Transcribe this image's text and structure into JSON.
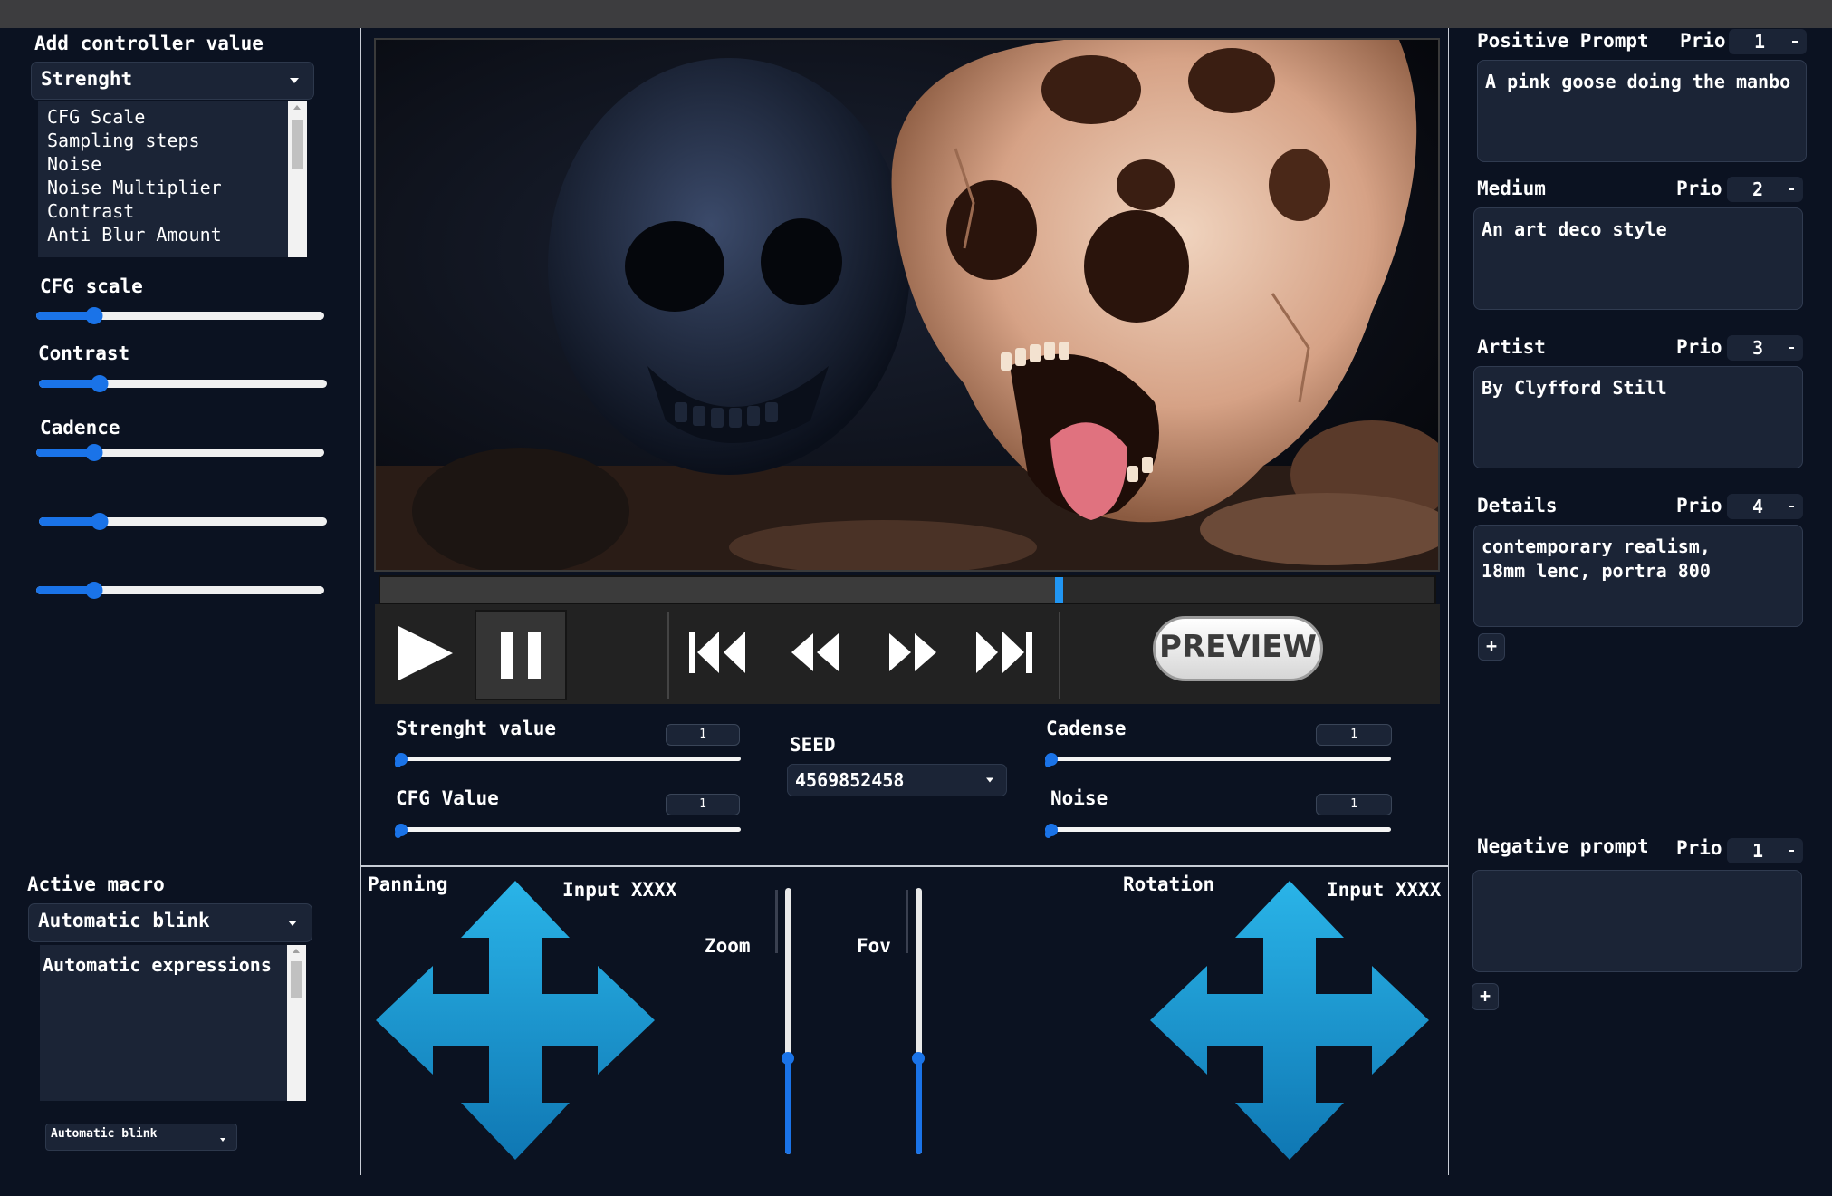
{
  "left_panel": {
    "add_controller_title": "Add controller value",
    "controller_select": "Strenght",
    "controller_list": [
      "CFG Scale",
      "Sampling steps",
      "Noise",
      "Noise Multiplier",
      "Contrast",
      "Anti Blur Amount"
    ],
    "sliders": [
      {
        "label": "CFG scale",
        "value": 0.2
      },
      {
        "label": "Contrast",
        "value": 0.21
      },
      {
        "label": "Cadence",
        "value": 0.2
      },
      {
        "label": "",
        "value": 0.21
      },
      {
        "label": "",
        "value": 0.2
      }
    ],
    "active_macro_title": "Active macro",
    "macro_select": "Automatic blink",
    "macro_list": [
      "Automatic expressions"
    ],
    "macro_small_select": "Automatic blink"
  },
  "player": {
    "progress": 0.64,
    "preview_label": "PREVIEW",
    "icons": [
      "play-icon",
      "pause-icon",
      "skip-to-start-icon",
      "rewind-icon",
      "fast-forward-icon",
      "skip-to-end-icon"
    ]
  },
  "params": {
    "strength_label": "Strenght value",
    "strength_value": "1",
    "strength_level": 0.0,
    "cfg_label": "CFG Value",
    "cfg_value": "1",
    "cfg_level": 0.0,
    "seed_label": "SEED",
    "seed_value": "4569852458",
    "cadense_label": "Cadense",
    "cadense_value": "1",
    "cadense_level": 0.0,
    "noise_label": "Noise",
    "noise_value": "1",
    "noise_level": 0.0
  },
  "motion": {
    "panning_label": "Panning",
    "panning_input": "Input XXXX",
    "zoom_label": "Zoom",
    "zoom_level": 0.36,
    "fov_label": "Fov",
    "fov_level": 0.36,
    "rotation_label": "Rotation",
    "rotation_input": "Input XXXX"
  },
  "prompts": {
    "prio_label": "Prio",
    "positive": {
      "label": "Positive Prompt",
      "prio": "1",
      "text": "A pink goose doing the manbo"
    },
    "medium": {
      "label": "Medium",
      "prio": "2",
      "text": "An art deco style"
    },
    "artist": {
      "label": "Artist",
      "prio": "3",
      "text": "By Clyfford Still"
    },
    "details": {
      "label": "Details",
      "prio": "4",
      "text": "contemporary realism,\n18mm lenc, portra 800"
    },
    "negative": {
      "label": "Negative prompt",
      "prio": "1",
      "text": ""
    },
    "add_label": "+"
  },
  "colors": {
    "background": "#0b1221",
    "panel": "#1b2436",
    "accent": "#1a73e8",
    "arrow": "#1ba3d8"
  }
}
